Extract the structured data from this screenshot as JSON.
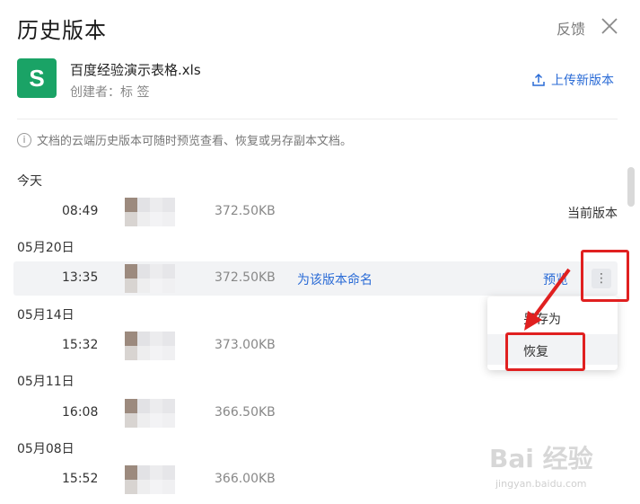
{
  "header": {
    "title": "历史版本",
    "feedback": "反馈"
  },
  "file": {
    "icon_letter": "S",
    "name": "百度经验演示表格.xls",
    "creator": "创建者：标 签",
    "upload_label": "上传新版本"
  },
  "info": "文档的云端历史版本可随时预览查看、恢复或另存副本文档。",
  "groups": [
    {
      "label": "今天",
      "rows": [
        {
          "time": "08:49",
          "size": "372.50KB",
          "status": "当前版本"
        }
      ]
    },
    {
      "label": "05月20日",
      "rows": [
        {
          "time": "13:35",
          "size": "372.50KB",
          "rename": "为该版本命名",
          "preview": "预览"
        }
      ]
    },
    {
      "label": "05月14日",
      "rows": [
        {
          "time": "15:32",
          "size": "373.00KB"
        }
      ]
    },
    {
      "label": "05月11日",
      "rows": [
        {
          "time": "16:08",
          "size": "366.50KB"
        }
      ]
    },
    {
      "label": "05月08日",
      "rows": [
        {
          "time": "15:52",
          "size": "366.00KB"
        }
      ]
    }
  ],
  "menu": {
    "save_as": "另存为",
    "restore": "恢复"
  },
  "watermark": {
    "main": "Bai 经验",
    "sub": "jingyan.baidu.com"
  },
  "colors": {
    "accent": "#2a6bd6",
    "file_icon": "#1aa366",
    "highlight": "#e02020"
  }
}
